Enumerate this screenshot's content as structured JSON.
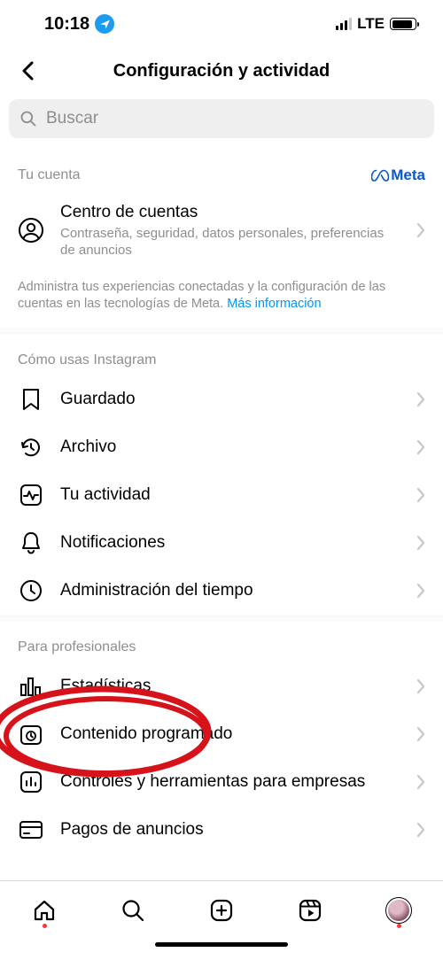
{
  "status": {
    "time": "10:18",
    "network": "LTE"
  },
  "header": {
    "title": "Configuración y actividad"
  },
  "search": {
    "placeholder": "Buscar"
  },
  "account": {
    "header": "Tu cuenta",
    "meta_brand": "Meta",
    "center_title": "Centro de cuentas",
    "center_sub": "Contraseña, seguridad, datos personales, preferencias de anuncios",
    "note": "Administra tus experiencias conectadas y la configuración de las cuentas en las tecnologías de Meta.",
    "note_link": "Más información"
  },
  "usage": {
    "header": "Cómo usas Instagram",
    "items": [
      {
        "label": "Guardado"
      },
      {
        "label": "Archivo"
      },
      {
        "label": "Tu actividad"
      },
      {
        "label": "Notificaciones"
      },
      {
        "label": "Administración del tiempo"
      }
    ]
  },
  "professional": {
    "header": "Para profesionales",
    "items": [
      {
        "label": "Estadísticas"
      },
      {
        "label": "Contenido programado"
      },
      {
        "label": "Controles y herramientas para empresas"
      },
      {
        "label": "Pagos de anuncios"
      }
    ]
  }
}
